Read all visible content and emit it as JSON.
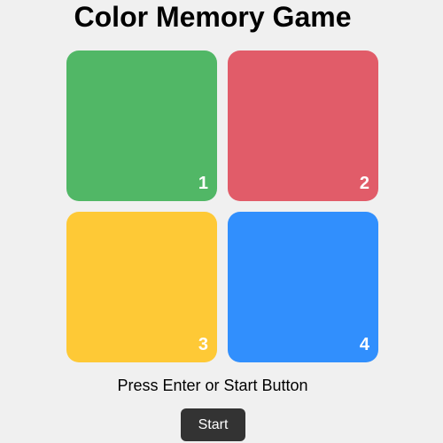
{
  "title": "Color Memory Game",
  "tiles": [
    {
      "number": "1",
      "color": "#51b766"
    },
    {
      "number": "2",
      "color": "#e15c69"
    },
    {
      "number": "3",
      "color": "#fec936"
    },
    {
      "number": "4",
      "color": "#318ffd"
    }
  ],
  "instructions": "Press Enter or Start Button",
  "start_button": {
    "label": "Start",
    "color": "#333333"
  }
}
